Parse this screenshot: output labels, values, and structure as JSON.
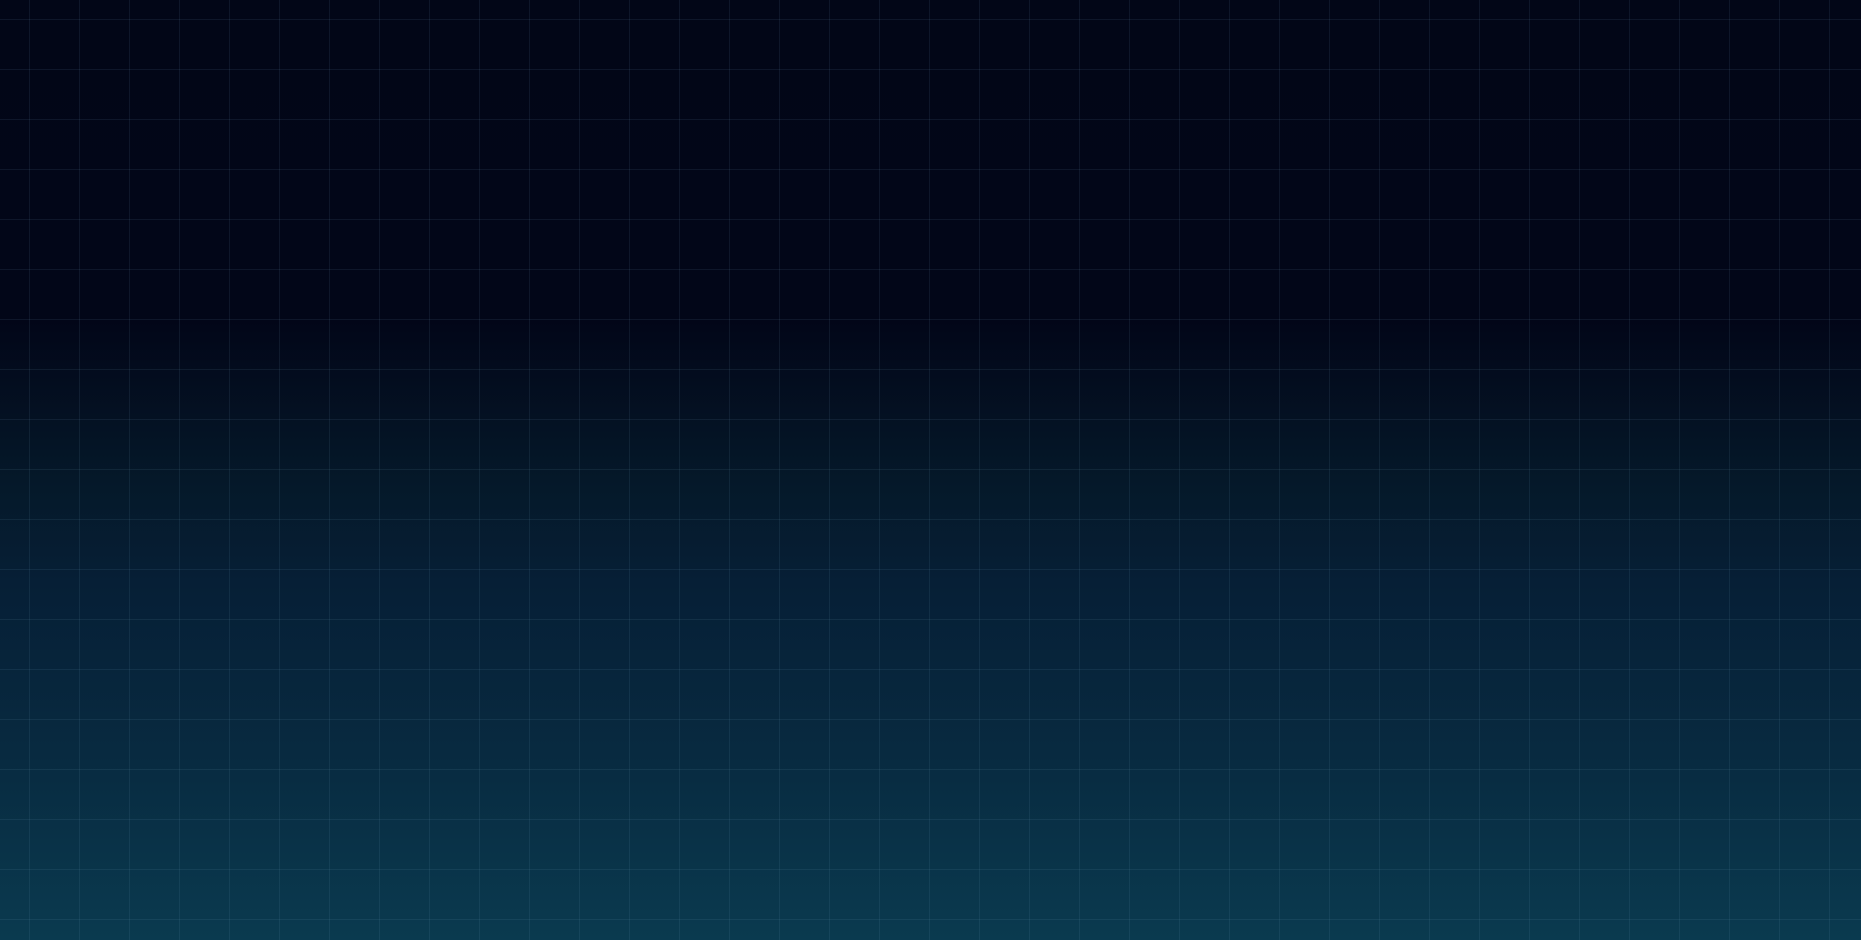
{
  "colors": {
    "background_top": "#020617",
    "background_bottom": "#0a3a4f",
    "grid_line": "#1c3a4e",
    "edge": "#ffffff"
  }
}
